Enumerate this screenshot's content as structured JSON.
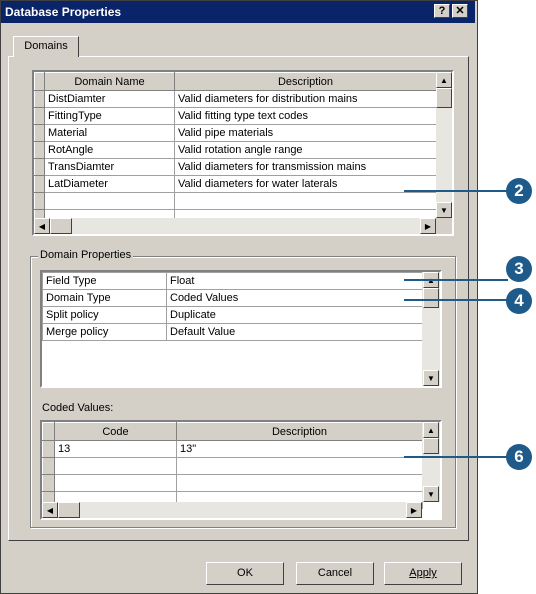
{
  "window": {
    "title": "Database Properties",
    "help_button": "?",
    "close_button": "✕"
  },
  "tabs": [
    {
      "label": "Domains"
    }
  ],
  "domains_grid": {
    "columns": [
      "Domain Name",
      "Description"
    ],
    "rows": [
      [
        "DistDiamter",
        "Valid diameters for distribution mains"
      ],
      [
        "FittingType",
        "Valid fitting type text codes"
      ],
      [
        "Material",
        "Valid pipe materials"
      ],
      [
        "RotAngle",
        "Valid rotation angle range"
      ],
      [
        "TransDiamter",
        "Valid diameters for transmission mains"
      ],
      [
        "LatDiameter",
        "Valid diameters for water laterals"
      ],
      [
        "",
        ""
      ]
    ]
  },
  "domain_properties": {
    "group_label": "Domain Properties",
    "rows": [
      [
        "Field Type",
        "Float"
      ],
      [
        "Domain Type",
        "Coded Values"
      ],
      [
        "Split policy",
        "Duplicate"
      ],
      [
        "Merge policy",
        "Default Value"
      ]
    ]
  },
  "coded_values": {
    "label": "Coded Values:",
    "columns": [
      "Code",
      "Description"
    ],
    "rows": [
      [
        "13",
        "13\""
      ],
      [
        "",
        ""
      ],
      [
        "",
        ""
      ],
      [
        "",
        ""
      ]
    ]
  },
  "buttons": {
    "ok": "OK",
    "cancel": "Cancel",
    "apply": "Apply"
  },
  "callouts": [
    "2",
    "3",
    "4",
    "6"
  ],
  "colors": {
    "title_bar": "#0a246a",
    "dialog_face": "#d4d0c8",
    "callout": "#1e5a8a"
  }
}
